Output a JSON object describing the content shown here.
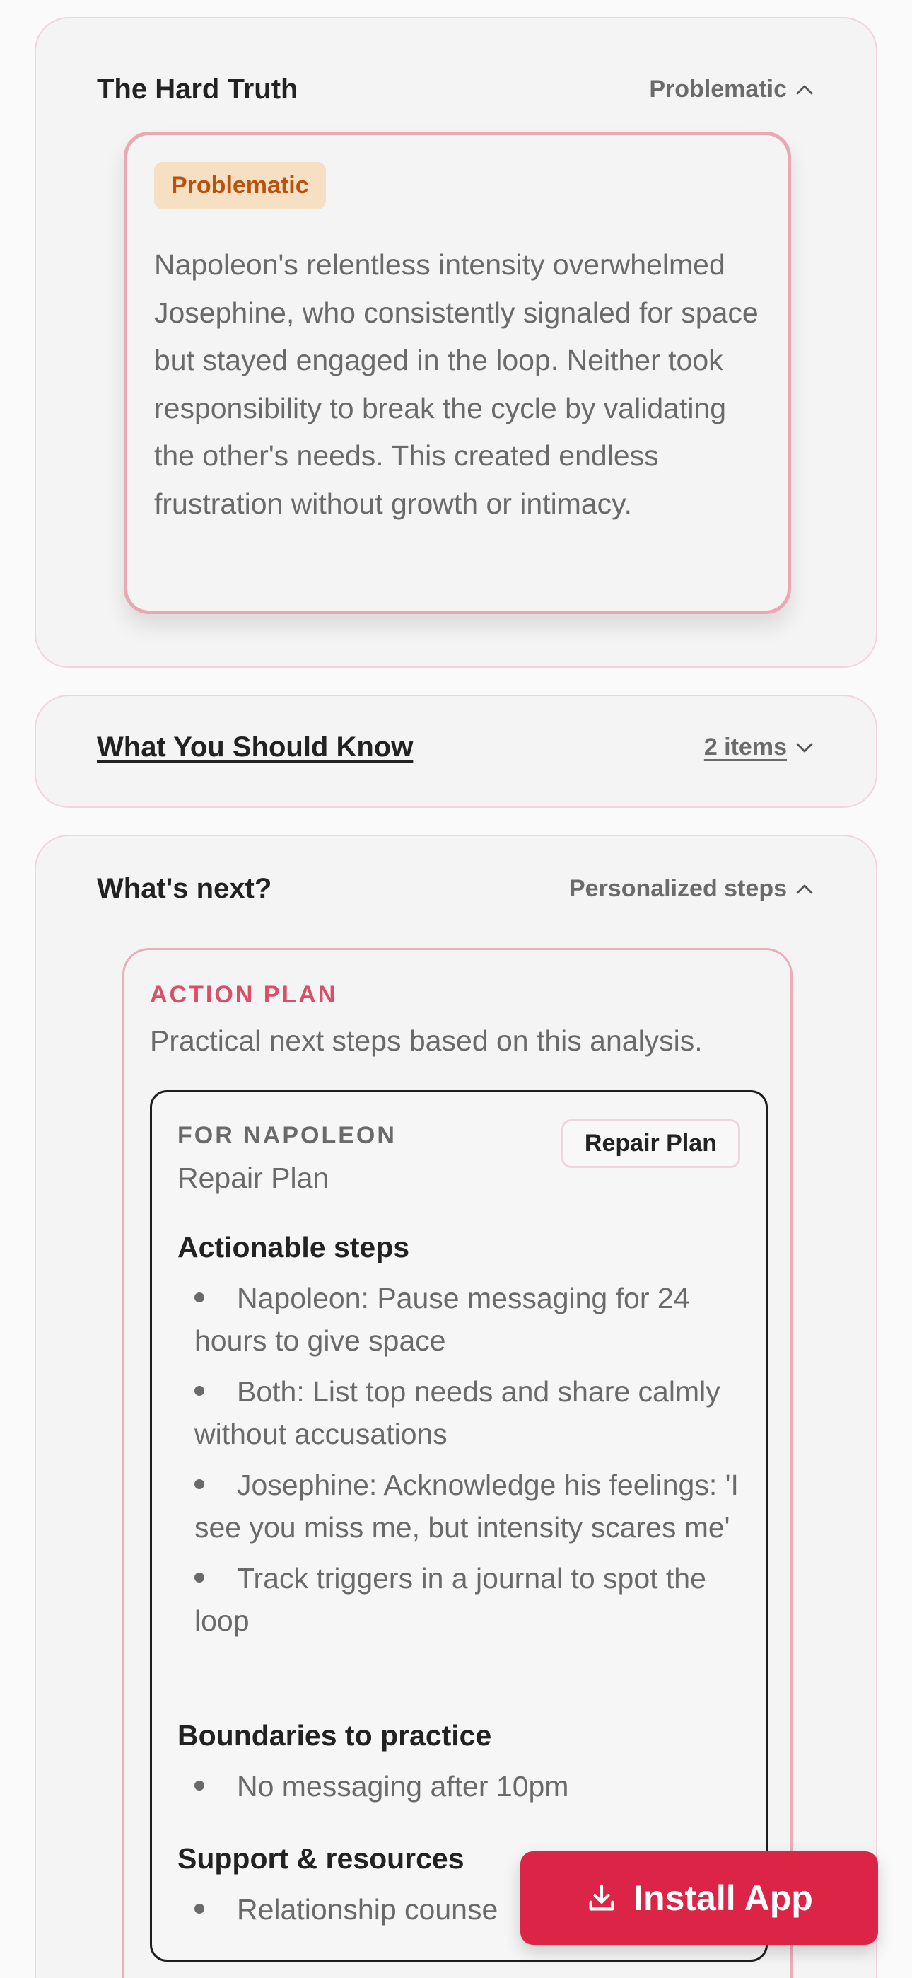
{
  "colors": {
    "accent": "#dc2446",
    "badge_text": "#b7530e",
    "badge_bg": "#f6dfc2",
    "kicker": "#d94f66"
  },
  "hard_truth": {
    "title": "The Hard Truth",
    "meta": "Problematic",
    "badge": "Problematic",
    "text": "Napoleon's relentless intensity overwhelmed Josephine, who consistently signaled for space but stayed engaged in the loop. Neither took responsibility to break the cycle by validating the other's needs. This created endless frustration without growth or intimacy."
  },
  "should_know": {
    "title": "What You Should Know",
    "meta": "2 items"
  },
  "whats_next": {
    "title": "What's next?",
    "meta": "Personalized steps",
    "plan": {
      "kicker": "ACTION PLAN",
      "subtitle": "Practical next steps based on this analysis.",
      "card": {
        "for_label": "FOR NAPOLEON",
        "subtitle": "Repair Plan",
        "chip": "Repair Plan",
        "steps_title": "Actionable steps",
        "steps": [
          "Napoleon: Pause messaging for 24 hours to give space",
          "Both: List top needs and share calmly without accusations",
          "Josephine: Acknowledge his feelings: 'I see you miss me, but intensity scares me'",
          "Track triggers in a journal to spot the loop"
        ],
        "boundaries_title": "Boundaries to practice",
        "boundaries": [
          "No messaging after 10pm"
        ],
        "support_title": "Support & resources",
        "support": [
          "Relationship counse"
        ]
      }
    }
  },
  "install_button": {
    "label": "Install App",
    "icon": "download-icon"
  }
}
